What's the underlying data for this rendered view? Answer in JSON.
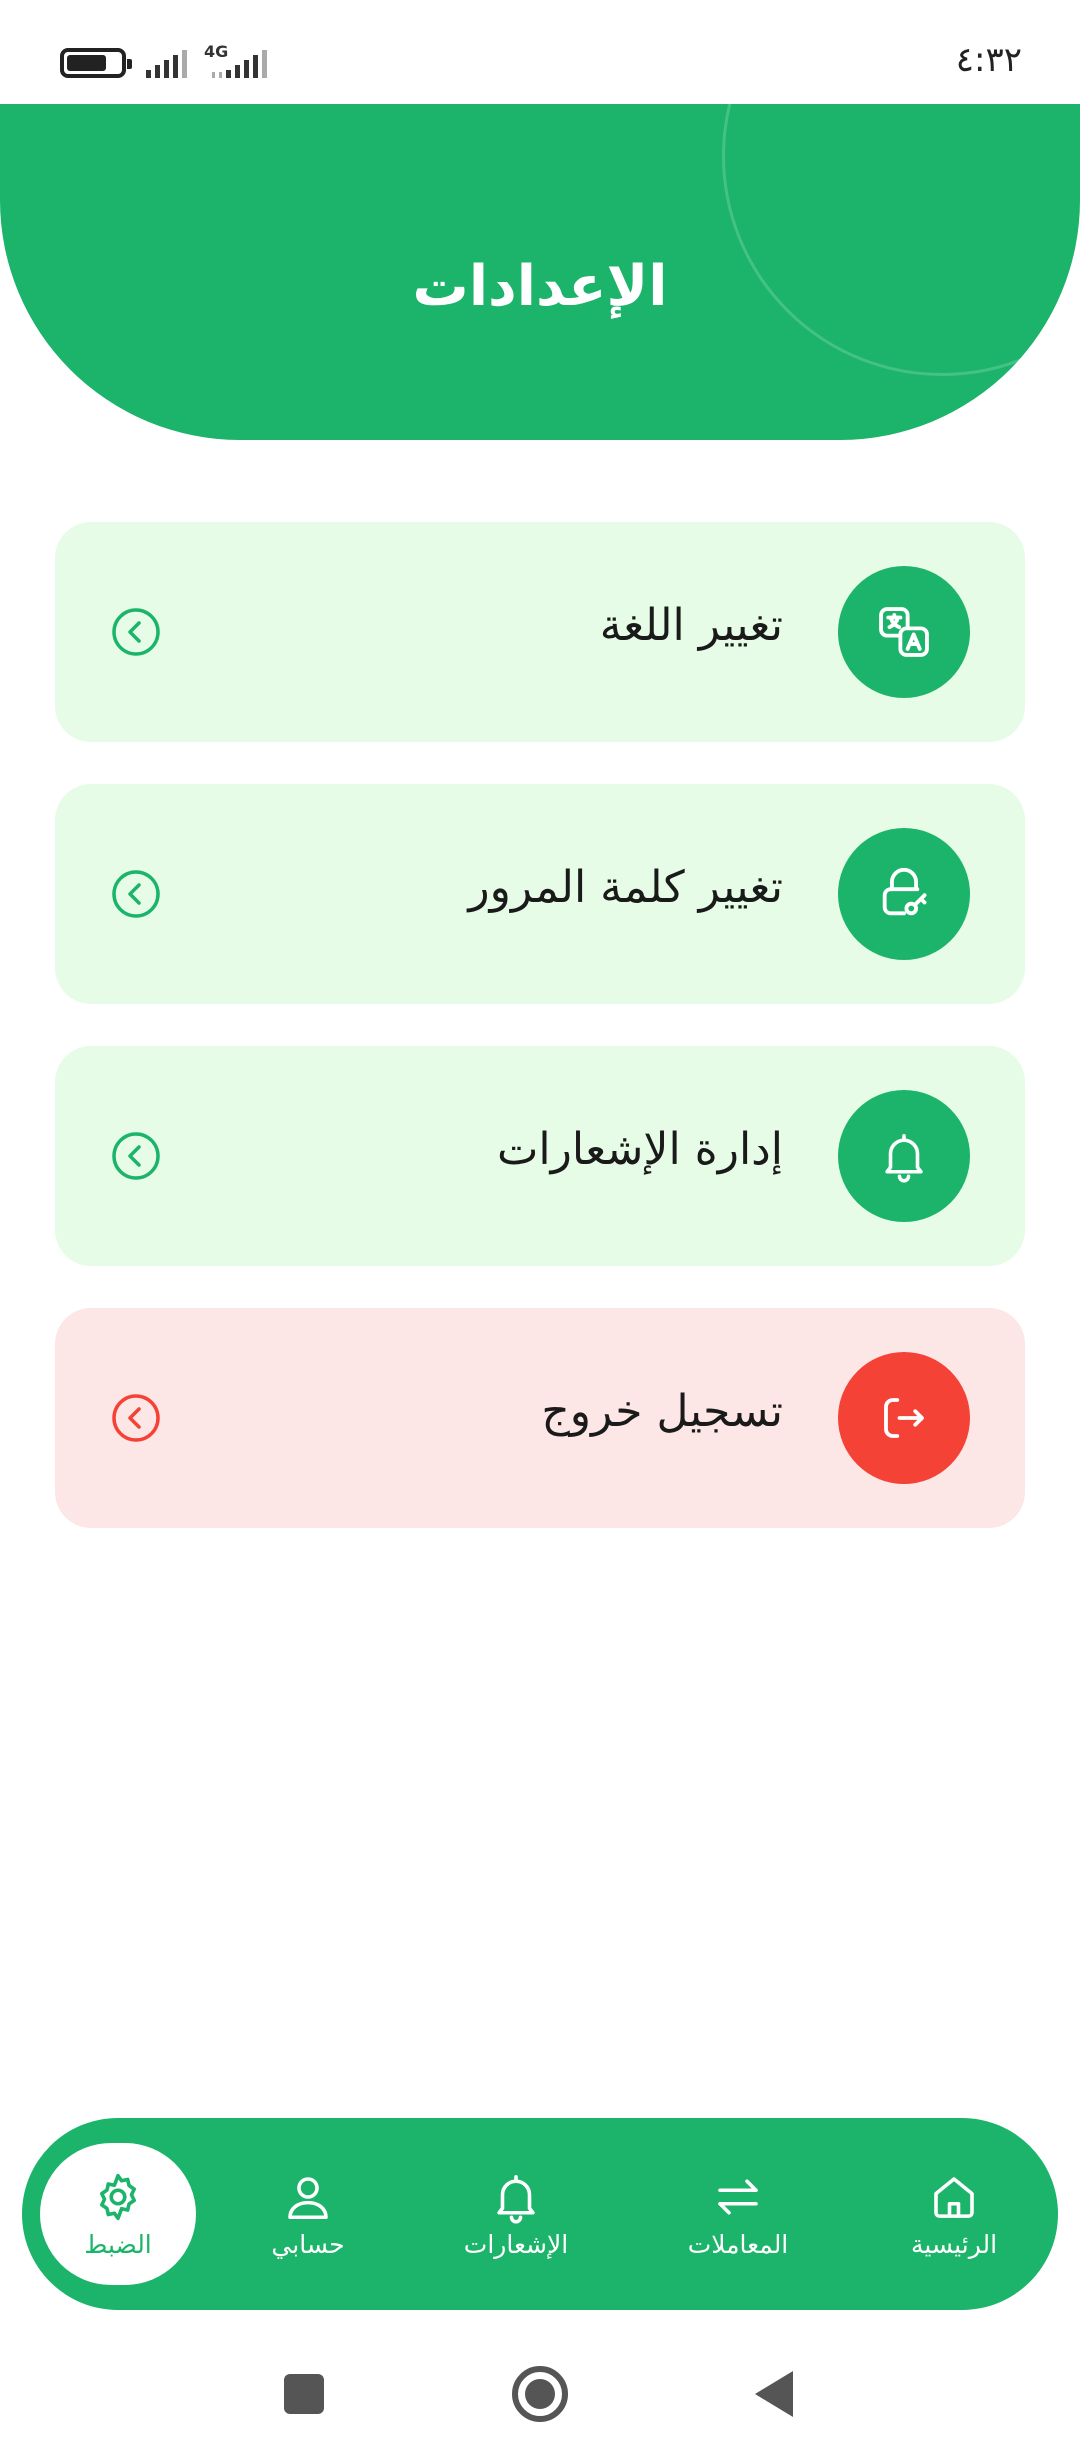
{
  "status_bar": {
    "time": "٤:٣٢",
    "network": "4G",
    "battery_level": 0.75
  },
  "header": {
    "title": "الإعدادات"
  },
  "settings": {
    "items": [
      {
        "label": "تغيير اللغة",
        "icon": "translate-icon",
        "variant": "default"
      },
      {
        "label": "تغيير كلمة المرور",
        "icon": "lock-key-icon",
        "variant": "default"
      },
      {
        "label": "إدارة الإشعارات",
        "icon": "bell-icon",
        "variant": "default"
      },
      {
        "label": "تسجيل خروج",
        "icon": "logout-icon",
        "variant": "danger"
      }
    ]
  },
  "bottom_nav": {
    "items": [
      {
        "label": "الرئيسية",
        "icon": "home-icon",
        "active": false
      },
      {
        "label": "المعاملات",
        "icon": "transfer-arrows-icon",
        "active": false
      },
      {
        "label": "الإشعارات",
        "icon": "bell-icon",
        "active": false
      },
      {
        "label": "حسابي",
        "icon": "user-icon",
        "active": false
      },
      {
        "label": "الضبط",
        "icon": "gear-icon",
        "active": true
      }
    ]
  },
  "colors": {
    "primary": "#1bb46a",
    "card_bg": "#e6fce6",
    "danger": "#f44236",
    "danger_bg": "#fce6e6"
  }
}
